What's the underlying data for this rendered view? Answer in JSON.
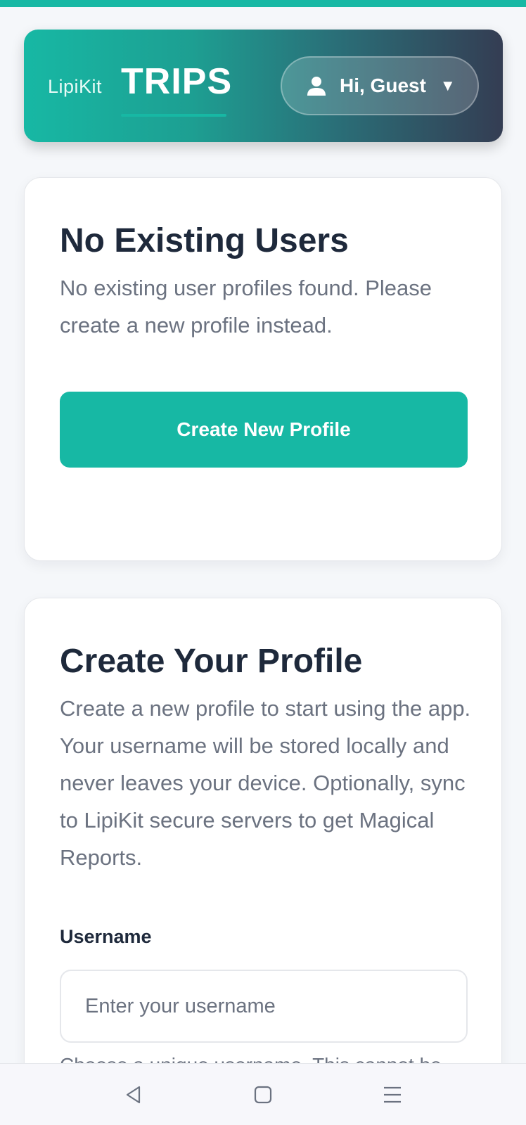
{
  "header": {
    "brand_small": "LipiKit",
    "brand_big": "TRIPS",
    "user_greeting": "Hi, Guest",
    "caret": "▼",
    "colors": {
      "accent": "#17b8a4",
      "gradient_end": "#343d53"
    }
  },
  "no_users_card": {
    "title": "No Existing Users",
    "description": "No existing user profiles found. Please create a new profile instead.",
    "button_label": "Create New Profile"
  },
  "create_profile_card": {
    "title": "Create Your Profile",
    "description": "Create a new profile to start using the app. Your username will be stored locally and never leaves your device. Optionally, sync to LipiKit secure servers to get Magical Reports.",
    "username_label": "Username",
    "username_placeholder": "Enter your username",
    "username_value": "",
    "helper_text": "Choose a unique username. This cannot be"
  },
  "system_nav": {
    "back_icon": "back-triangle-icon",
    "home_icon": "home-square-icon",
    "menu_icon": "menu-lines-icon"
  }
}
